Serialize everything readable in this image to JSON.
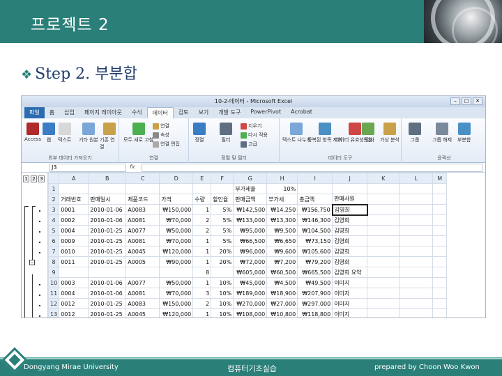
{
  "slide": {
    "title": "프로젝트 2",
    "step_bullet": "❖",
    "step_heading": "Step 2. 부분합"
  },
  "excel": {
    "window_title": "10-2-데이터 - Microsoft Excel",
    "window_buttons": [
      "–",
      "□",
      "✕"
    ],
    "tabs": [
      {
        "label": "파일",
        "active": false,
        "file": true
      },
      {
        "label": "홈",
        "active": false
      },
      {
        "label": "삽입",
        "active": false
      },
      {
        "label": "페이지 레이아웃",
        "active": false
      },
      {
        "label": "수식",
        "active": false
      },
      {
        "label": "데이터",
        "active": true
      },
      {
        "label": "검토",
        "active": false
      },
      {
        "label": "보기",
        "active": false
      },
      {
        "label": "개발 도구",
        "active": false
      },
      {
        "label": "PowerPivot",
        "active": false
      },
      {
        "label": "Acrobat",
        "active": false
      }
    ],
    "ribbon": {
      "get_external": {
        "buttons": [
          "Access",
          "웹",
          "텍스트",
          "기타 원본",
          "기존 연결"
        ],
        "label": "외부 데이터 가져오기"
      },
      "connections": {
        "buttons": [
          "모두 새로 고침",
          "연결",
          "속성",
          "연결 편집"
        ],
        "label": "연결"
      },
      "sort_filter": {
        "buttons": [
          "정렬",
          "필터",
          "지우기",
          "다시 적용",
          "고급"
        ],
        "label": "정렬 및 필터"
      },
      "data_tools": {
        "buttons": [
          "텍스트 나누기",
          "중복된 항목 제거",
          "데이터 유효성 검사",
          "통합",
          "가상 분석"
        ],
        "label": "데이터 도구"
      },
      "outline": {
        "buttons": [
          "그룹",
          "그룹 해제",
          "부분합"
        ],
        "label": "윤곽선"
      }
    },
    "name_box": "J3",
    "fx_label": "fx",
    "formula": "",
    "outline_levels": [
      "1",
      "2",
      "3"
    ],
    "columns": [
      "",
      "A",
      "B",
      "C",
      "D",
      "E",
      "F",
      "G",
      "H",
      "I",
      "J",
      "K",
      "L",
      "M"
    ],
    "rows": [
      {
        "n": "1",
        "cells": [
          "",
          "",
          "",
          "",
          "",
          "",
          "부가세율",
          "10%",
          "",
          "",
          "",
          "",
          ""
        ]
      },
      {
        "n": "2",
        "cells": [
          "거래번호",
          "판매일시",
          "제품코드",
          "가격",
          "수량",
          "할인율",
          "판매금액",
          "부가세",
          "총금액",
          "판매사원",
          "",
          "",
          ""
        ]
      },
      {
        "n": "3",
        "cells": [
          "0001",
          "2010-01-06",
          "A0083",
          "₩150,000",
          "1",
          "5%",
          "₩142,500",
          "₩14,250",
          "₩156,750",
          "김영희",
          "",
          "",
          ""
        ]
      },
      {
        "n": "4",
        "cells": [
          "0002",
          "2010-01-06",
          "A0081",
          "₩70,000",
          "2",
          "5%",
          "₩133,000",
          "₩13,300",
          "₩146,300",
          "김영희",
          "",
          "",
          ""
        ]
      },
      {
        "n": "5",
        "cells": [
          "0004",
          "2010-01-25",
          "A0077",
          "₩50,000",
          "2",
          "5%",
          "₩95,000",
          "₩9,500",
          "₩104,500",
          "김영희",
          "",
          "",
          ""
        ]
      },
      {
        "n": "6",
        "cells": [
          "0009",
          "2010-01-25",
          "A0081",
          "₩70,000",
          "1",
          "5%",
          "₩66,500",
          "₩6,650",
          "₩73,150",
          "김영희",
          "",
          "",
          ""
        ]
      },
      {
        "n": "7",
        "cells": [
          "0010",
          "2010-01-25",
          "A0045",
          "₩120,000",
          "1",
          "20%",
          "₩96,000",
          "₩9,600",
          "₩105,600",
          "김영희",
          "",
          "",
          ""
        ]
      },
      {
        "n": "8",
        "cells": [
          "0011",
          "2010-01-25",
          "A0005",
          "₩90,000",
          "1",
          "20%",
          "₩72,000",
          "₩7,200",
          "₩79,200",
          "김영희",
          "",
          "",
          ""
        ]
      },
      {
        "n": "9",
        "cells": [
          "",
          "",
          "",
          "",
          "8",
          "",
          "₩605,000",
          "₩60,500",
          "₩665,500",
          "김영희 요약",
          "",
          "",
          ""
        ]
      },
      {
        "n": "10",
        "cells": [
          "0003",
          "2010-01-06",
          "A0077",
          "₩50,000",
          "1",
          "10%",
          "₩45,000",
          "₩4,500",
          "₩49,500",
          "이미지",
          "",
          "",
          ""
        ]
      },
      {
        "n": "11",
        "cells": [
          "0004",
          "2010-01-06",
          "A0081",
          "₩70,000",
          "3",
          "10%",
          "₩189,000",
          "₩18,900",
          "₩207,900",
          "이미지",
          "",
          "",
          ""
        ]
      },
      {
        "n": "12",
        "cells": [
          "0012",
          "2010-01-25",
          "A0083",
          "₩150,000",
          "2",
          "10%",
          "₩270,000",
          "₩27,000",
          "₩297,000",
          "이미지",
          "",
          "",
          ""
        ]
      },
      {
        "n": "13",
        "cells": [
          "0012",
          "2010-01-25",
          "A0045",
          "₩120,000",
          "1",
          "10%",
          "₩108,000",
          "₩10,800",
          "₩118,800",
          "이미지",
          "",
          "",
          ""
        ]
      }
    ]
  },
  "footer": {
    "left": "Dongyang Mirae University",
    "center": "컴퓨터기초실습",
    "right": "prepared by Choon Woo Kwon"
  },
  "colors": {
    "teal": "#2a7f79",
    "ribbon": "#e4ecf7"
  }
}
